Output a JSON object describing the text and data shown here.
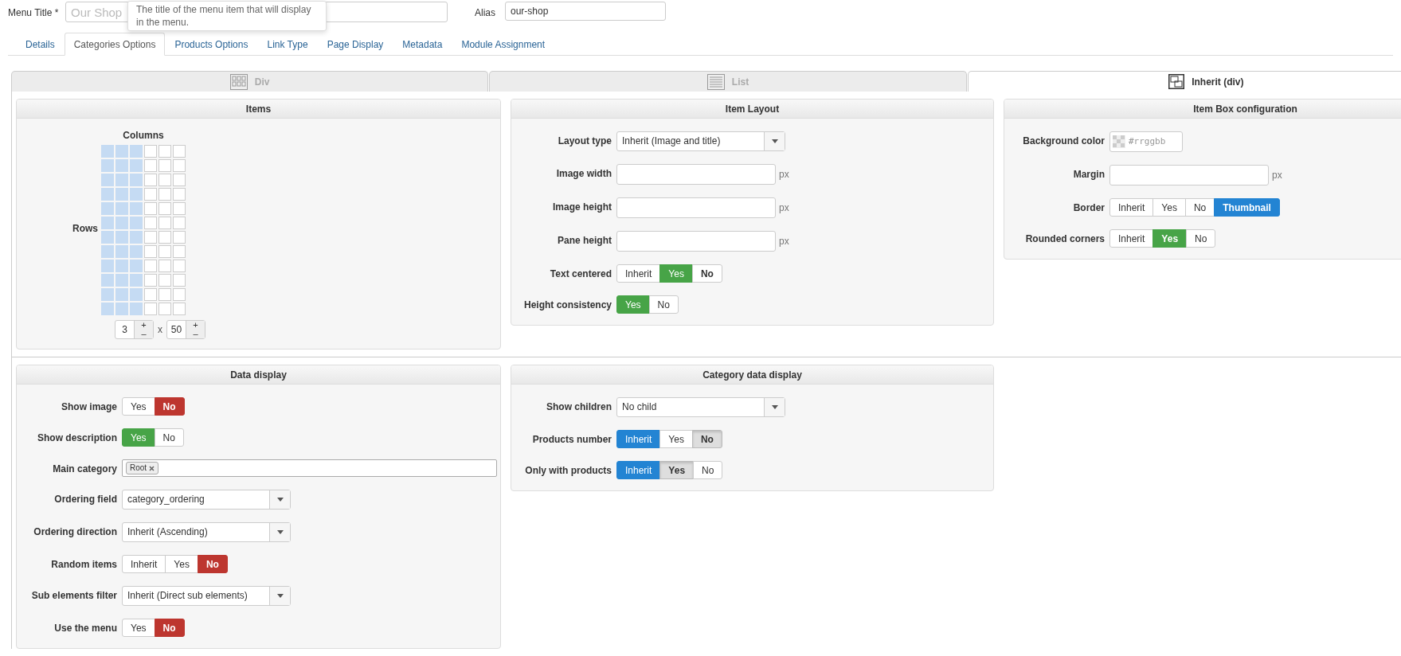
{
  "menu_title": {
    "label": "Menu Title *",
    "placeholder": "Our Shop",
    "tooltip": "The title of the menu item that will display in the menu."
  },
  "alias": {
    "label": "Alias",
    "value": "our-shop"
  },
  "tabs": [
    {
      "label": "Details",
      "selected": false
    },
    {
      "label": "Categories Options",
      "selected": true
    },
    {
      "label": "Products Options",
      "selected": false
    },
    {
      "label": "Link Type",
      "selected": false
    },
    {
      "label": "Page Display",
      "selected": false
    },
    {
      "label": "Metadata",
      "selected": false
    },
    {
      "label": "Module Assignment",
      "selected": false
    }
  ],
  "layout_modes": [
    {
      "label": "Div",
      "kind": "grid",
      "selected": false
    },
    {
      "label": "List",
      "kind": "list",
      "selected": false
    },
    {
      "label": "Inherit (div)",
      "kind": "inherit",
      "selected": true
    }
  ],
  "items_panel": {
    "title": "Items",
    "columns_label": "Columns",
    "rows_label": "Rows",
    "grid_columns": [
      {
        "filled": true
      },
      {
        "filled": true
      },
      {
        "filled": true
      },
      {
        "filled": false
      },
      {
        "filled": false
      },
      {
        "filled": false
      }
    ],
    "grid_rows": [
      {
        "filled": true
      },
      {
        "filled": true
      },
      {
        "filled": true
      },
      {
        "filled": true
      },
      {
        "filled": true
      },
      {
        "filled": true
      },
      {
        "filled": true
      },
      {
        "filled": true
      },
      {
        "filled": true
      },
      {
        "filled": true
      },
      {
        "filled": true
      },
      {
        "filled": true
      }
    ],
    "steppers": [
      {
        "value": "3",
        "plus": "+",
        "minus": "–"
      },
      {
        "value": "50",
        "plus": "+",
        "minus": "–"
      }
    ],
    "separator": "x"
  },
  "panels_top": [
    {
      "title": "Item Layout",
      "fields": [
        {
          "kind": "select",
          "label": "Layout type",
          "value": "Inherit (Image and title)"
        },
        {
          "kind": "text",
          "label": "Image width",
          "unit": "px"
        },
        {
          "kind": "text",
          "label": "Image height",
          "unit": "px"
        },
        {
          "kind": "text",
          "label": "Pane height",
          "unit": "px"
        },
        {
          "kind": "toggle",
          "label": "Text centered",
          "color": "#47a447",
          "options": [
            {
              "label": "Inherit",
              "selected": false,
              "pressed": false,
              "bold": false
            },
            {
              "label": "Yes",
              "selected": true,
              "pressed": false,
              "bold": false
            },
            {
              "label": "No",
              "selected": false,
              "pressed": false,
              "bold": true
            }
          ]
        },
        {
          "kind": "toggle",
          "label": "Height consistency",
          "color": "#47a447",
          "options": [
            {
              "label": "Yes",
              "selected": true,
              "pressed": false,
              "bold": false
            },
            {
              "label": "No",
              "selected": false,
              "pressed": false,
              "bold": false
            }
          ]
        }
      ]
    },
    {
      "title": "Item Box configuration",
      "fields": [
        {
          "kind": "color",
          "label": "Background color",
          "placeholder": "#rrggbb"
        },
        {
          "kind": "text",
          "label": "Margin",
          "unit": "px"
        },
        {
          "kind": "toggle",
          "label": "Border",
          "color": "#2384d3",
          "options": [
            {
              "label": "Inherit",
              "selected": false,
              "pressed": false,
              "bold": false
            },
            {
              "label": "Yes",
              "selected": false,
              "pressed": false,
              "bold": false
            },
            {
              "label": "No",
              "selected": false,
              "pressed": false,
              "bold": false
            },
            {
              "label": "Thumbnail",
              "selected": true,
              "pressed": false,
              "bold": true
            }
          ]
        },
        {
          "kind": "toggle",
          "label": "Rounded corners",
          "color": "#47a447",
          "options": [
            {
              "label": "Inherit",
              "selected": false,
              "pressed": false,
              "bold": false
            },
            {
              "label": "Yes",
              "selected": true,
              "pressed": false,
              "bold": true
            },
            {
              "label": "No",
              "selected": false,
              "pressed": false,
              "bold": false
            }
          ]
        }
      ]
    }
  ],
  "panels_bottom": [
    {
      "title": "Data display",
      "fields": [
        {
          "kind": "toggle",
          "label": "Show image",
          "color": "#bd362f",
          "options": [
            {
              "label": "Yes",
              "selected": false,
              "pressed": false,
              "bold": false
            },
            {
              "label": "No",
              "selected": true,
              "pressed": false,
              "bold": true
            }
          ]
        },
        {
          "kind": "toggle",
          "label": "Show description",
          "color": "#47a447",
          "options": [
            {
              "label": "Yes",
              "selected": true,
              "pressed": false,
              "bold": false
            },
            {
              "label": "No",
              "selected": false,
              "pressed": false,
              "bold": false
            }
          ]
        },
        {
          "kind": "tags",
          "label": "Main category",
          "tags": [
            {
              "label": "Root"
            }
          ]
        },
        {
          "kind": "select",
          "label": "Ordering field",
          "value": "category_ordering"
        },
        {
          "kind": "select",
          "label": "Ordering direction",
          "value": "Inherit (Ascending)"
        },
        {
          "kind": "toggle",
          "label": "Random items",
          "color": "#bd362f",
          "options": [
            {
              "label": "Inherit",
              "selected": false,
              "pressed": false,
              "bold": false
            },
            {
              "label": "Yes",
              "selected": false,
              "pressed": false,
              "bold": false
            },
            {
              "label": "No",
              "selected": true,
              "pressed": false,
              "bold": true
            }
          ]
        },
        {
          "kind": "select",
          "label": "Sub elements filter",
          "value": "Inherit (Direct sub elements)"
        },
        {
          "kind": "toggle",
          "label": "Use the menu",
          "color": "#bd362f",
          "options": [
            {
              "label": "Yes",
              "selected": false,
              "pressed": false,
              "bold": false
            },
            {
              "label": "No",
              "selected": true,
              "pressed": false,
              "bold": true
            }
          ]
        }
      ]
    },
    {
      "title": "Category data display",
      "fields": [
        {
          "kind": "select",
          "label": "Show children",
          "value": "No child"
        },
        {
          "kind": "toggle",
          "label": "Products number",
          "color": "#2384d3",
          "options": [
            {
              "label": "Inherit",
              "selected": true,
              "pressed": false,
              "bold": false
            },
            {
              "label": "Yes",
              "selected": false,
              "pressed": false,
              "bold": false
            },
            {
              "label": "No",
              "selected": false,
              "pressed": true,
              "bold": true
            }
          ]
        },
        {
          "kind": "toggle",
          "label": "Only with products",
          "color": "#2384d3",
          "options": [
            {
              "label": "Inherit",
              "selected": true,
              "pressed": false,
              "bold": false
            },
            {
              "label": "Yes",
              "selected": false,
              "pressed": true,
              "bold": true
            },
            {
              "label": "No",
              "selected": false,
              "pressed": false,
              "bold": false
            }
          ]
        }
      ]
    }
  ]
}
